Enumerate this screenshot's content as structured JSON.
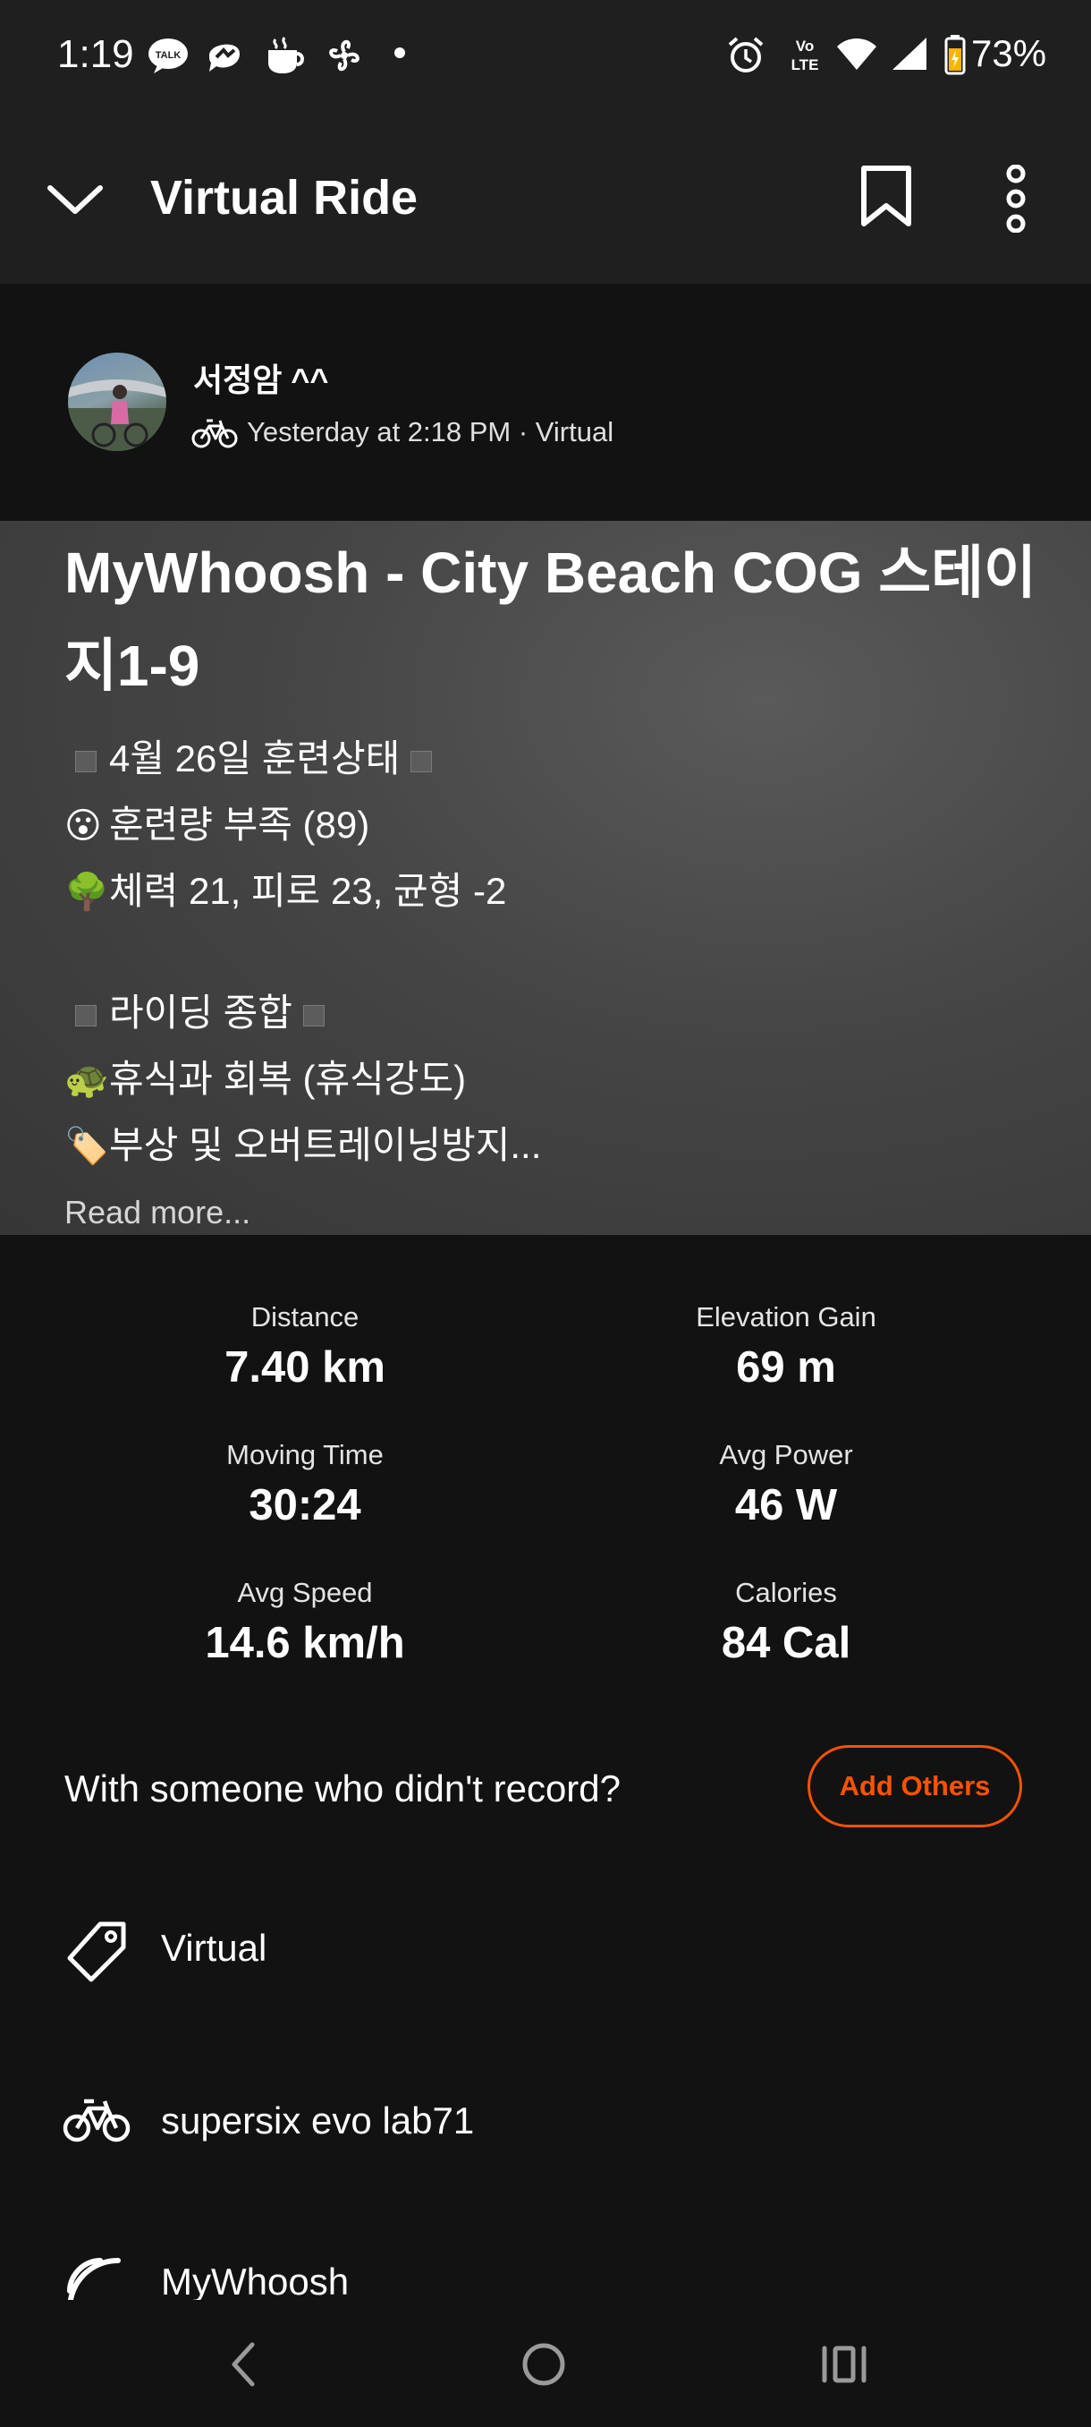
{
  "status_bar": {
    "time": "1:19",
    "notification_icons": [
      "kakaotalk-icon",
      "messenger-icon",
      "cup-icon",
      "pinwheel-icon",
      "dot-icon"
    ],
    "system_icons": [
      "alarm-icon",
      "volte-icon",
      "wifi-icon",
      "signal-icon",
      "battery-icon"
    ],
    "volte_label": "Vo LTE",
    "battery": "73%"
  },
  "app_bar": {
    "title": "Virtual Ride"
  },
  "activity": {
    "athlete_name": "서정암 ^^",
    "meta": "Yesterday at 2:18 PM · Virtual",
    "title": "MyWhoosh - City Beach COG 스테이지1-9",
    "description": [
      {
        "emoji": "",
        "text": "4월 26일 훈련상태",
        "boxed": true
      },
      {
        "emoji": "😮",
        "text": "훈련량 부족 (89)",
        "boxed": false
      },
      {
        "emoji": "🌳",
        "text": "체력 21, 피로 23, 균형 -2",
        "boxed": false
      },
      {
        "emoji": "",
        "text": "라이딩 종합",
        "boxed": true
      },
      {
        "emoji": "🐢",
        "text": "휴식과 회복 (휴식강도)",
        "boxed": false
      },
      {
        "emoji": "🏷️",
        "text": "부상 및 오버트레이닝방지...",
        "boxed": false
      }
    ],
    "read_more": "Read more..."
  },
  "stats": [
    {
      "label": "Distance",
      "value": "7.40 km"
    },
    {
      "label": "Elevation Gain",
      "value": "69 m"
    },
    {
      "label": "Moving Time",
      "value": "30:24"
    },
    {
      "label": "Avg Power",
      "value": "46 W"
    },
    {
      "label": "Avg Speed",
      "value": "14.6 km/h"
    },
    {
      "label": "Calories",
      "value": "84 Cal"
    }
  ],
  "with_someone": {
    "prompt": "With someone who didn't record?",
    "button": "Add Others"
  },
  "detail_rows": [
    {
      "icon": "tag-icon",
      "label": "Virtual"
    },
    {
      "icon": "bike-icon",
      "label": "supersix evo lab71"
    },
    {
      "icon": "device-icon",
      "label": "MyWhoosh"
    }
  ],
  "colors": {
    "accent": "#fc5200",
    "background": "#121212",
    "bar": "#1f1f1f"
  }
}
